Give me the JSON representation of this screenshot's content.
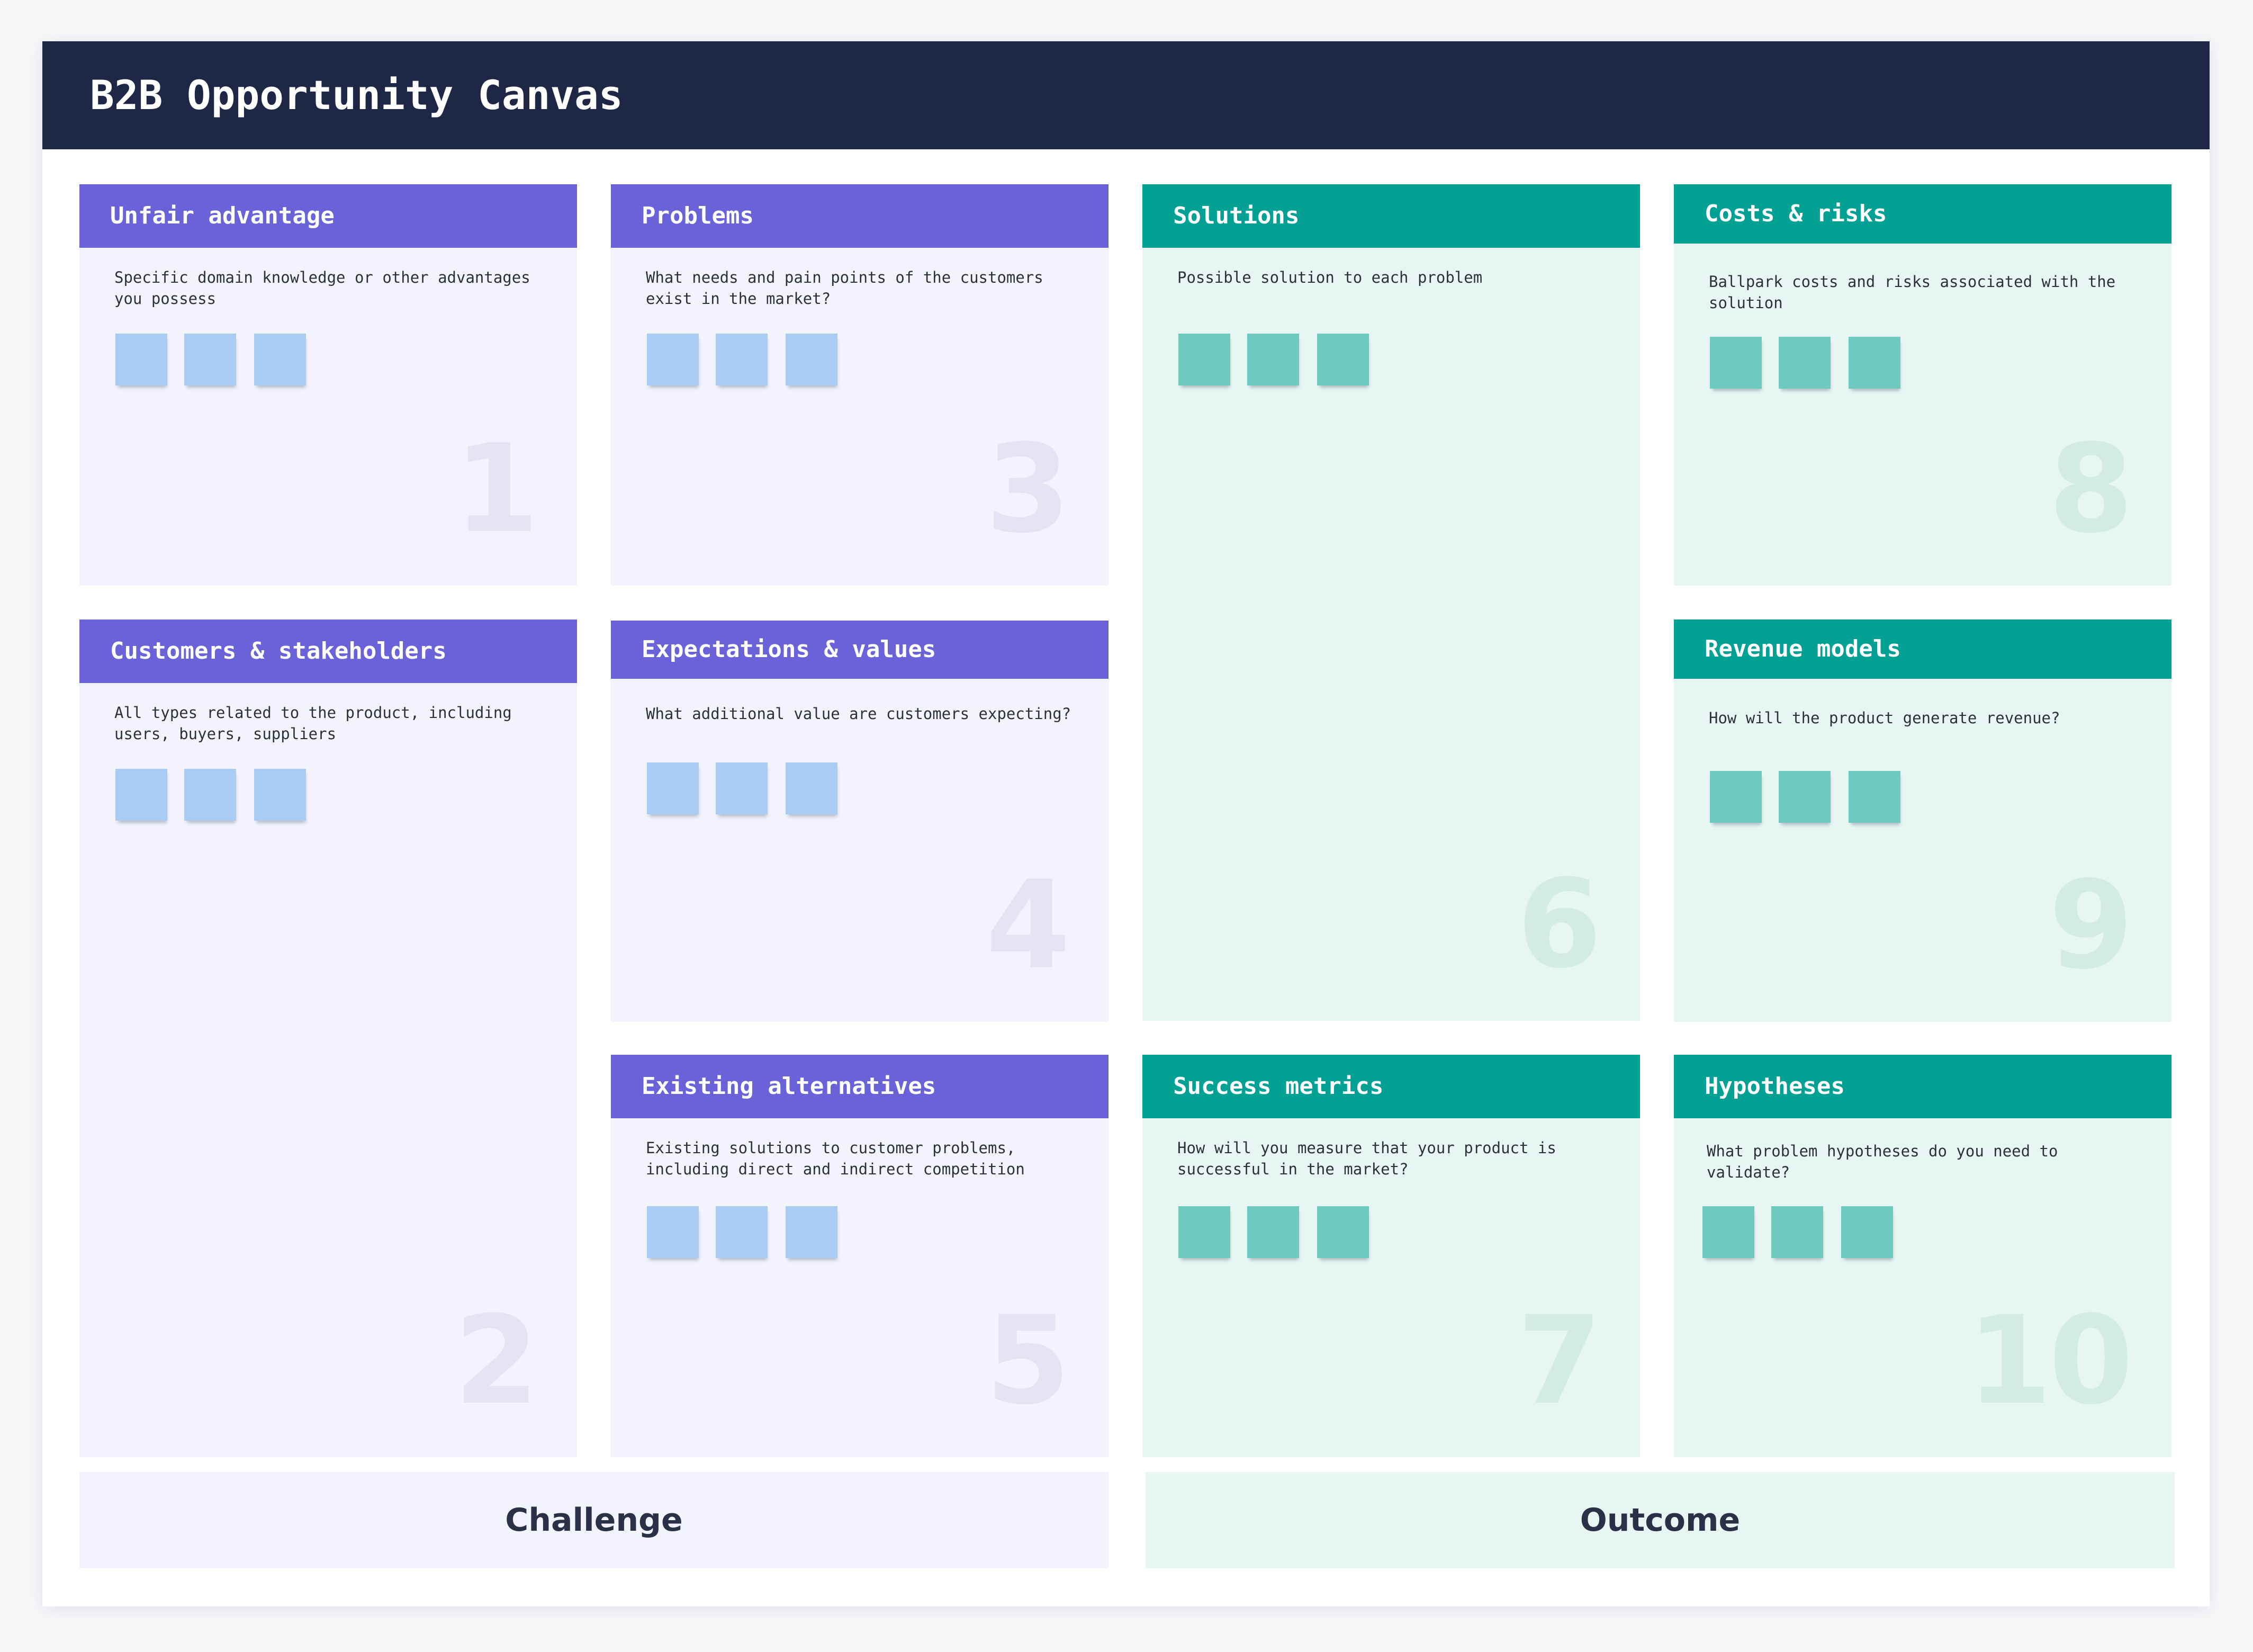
{
  "board": {
    "title": "B2B Opportunity Canvas"
  },
  "cards": {
    "unfair_advantage": {
      "title": "Unfair advantage",
      "description": "Specific domain knowledge or other advantages you possess",
      "number": "1"
    },
    "customers_stakeholders": {
      "title": "Customers & stakeholders",
      "description": "All types related to the product, including users, buyers, suppliers",
      "number": "2"
    },
    "problems": {
      "title": "Problems",
      "description": "What needs and pain points of the customers exist in the market?",
      "number": "3"
    },
    "expectations_values": {
      "title": "Expectations & values",
      "description": "What additional value are customers expecting?",
      "number": "4"
    },
    "existing_alternatives": {
      "title": "Existing alternatives",
      "description": "Existing solutions to customer problems, including direct and indirect competition",
      "number": "5"
    },
    "solutions": {
      "title": "Solutions",
      "description": "Possible solution to each problem",
      "number": "6"
    },
    "success_metrics": {
      "title": "Success metrics",
      "description": "How will you measure that your product is successful in the market?",
      "number": "7"
    },
    "costs_risks": {
      "title": "Costs & risks",
      "description": "Ballpark costs and risks associated with the solution",
      "number": "8"
    },
    "revenue_models": {
      "title": "Revenue models",
      "description": "How will the product generate revenue?",
      "number": "9"
    },
    "hypotheses": {
      "title": "Hypotheses",
      "description": "What problem hypotheses do you need to validate?",
      "number": "10"
    }
  },
  "zones": {
    "challenge": "Challenge",
    "outcome": "Outcome"
  },
  "colors": {
    "header_bg": "#1e2746",
    "challenge_accent": "#6a62d9",
    "outcome_accent": "#03a094",
    "challenge_note": "#a9cbf4",
    "outcome_note": "#6ec9bf"
  }
}
